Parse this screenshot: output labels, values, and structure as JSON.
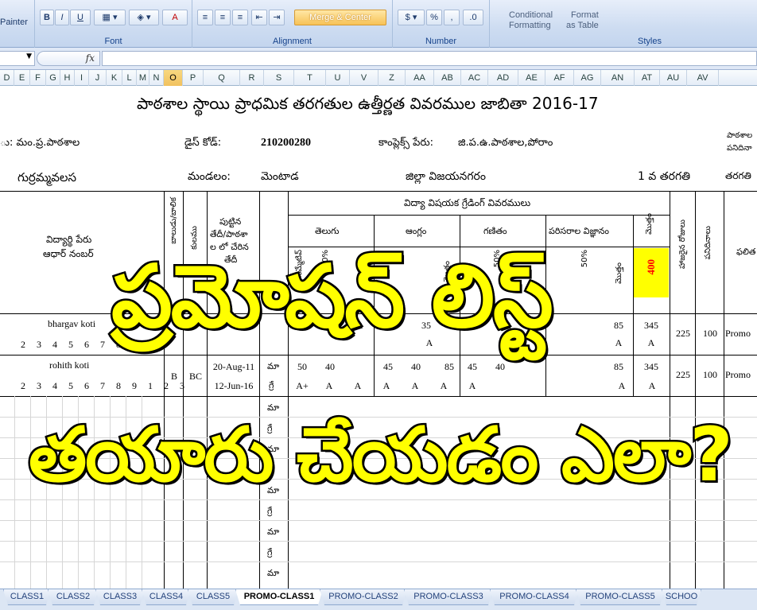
{
  "ribbon": {
    "painter_label": "Painter",
    "font_group": {
      "label": "Font",
      "bold": "B",
      "italic": "I",
      "underline": "U",
      "font_color": "A"
    },
    "alignment_group": {
      "label": "Alignment",
      "merge_center": "Merge & Center"
    },
    "number_group": {
      "label": "Number",
      "currency": "$",
      "percent": "%",
      "comma": ","
    },
    "styles_group": {
      "label": "Styles",
      "conditional_formatting": [
        "Conditional",
        "Formatting"
      ],
      "format_as_table": [
        "Format",
        "as Table"
      ]
    }
  },
  "formula_bar": {
    "fx": "fx",
    "value": ""
  },
  "columns": [
    "D",
    "E",
    "F",
    "G",
    "H",
    "I",
    "J",
    "K",
    "L",
    "M",
    "N",
    "O",
    "P",
    "Q",
    "R",
    "S",
    "T",
    "U",
    "V",
    "Z",
    "AA",
    "AB",
    "AC",
    "AD",
    "AE",
    "AF",
    "AG",
    "AN",
    "AT",
    "AU",
    "AV"
  ],
  "selected_column": "O",
  "sheet": {
    "title": "పాఠశాల స్థాయి ప్రాధమిక తరగతుల ఉత్తీర్ణత వివరముల జాబితా 2016-17",
    "school_label": "ు: మం.ప్ర.పాఠశాల",
    "dise_label": "డైస్ కోడ్:",
    "dise_value": "210200280",
    "complex_label": "కాంప్లెక్స్ పేరు:",
    "complex_value": "జి.ప.ఉ.పాఠశాల,పోరాం",
    "right_note_1": "పాఠశాల",
    "right_note_2": "పనిదినా",
    "village": "గుర్రమ్మవలస",
    "mandal_label": "మండలం:",
    "mandal_value": "మెంటాడ",
    "district": "జిల్లా విజయనగరం",
    "class_label": "1 వ తరగతి",
    "class_short": "తరగతి",
    "grading_header": "విద్యా విషయక గ్రేడింగ్ వివరములు",
    "student_name_header": "విద్యార్థి పేరు",
    "aadhaar_header": "ఆధార్ నంబర్",
    "dob_header": [
      "పుట్టిన",
      "తేదీ/పాఠశా",
      "ల లో చేరిన",
      "తేదీ"
    ],
    "subjects": [
      "తెలుగు",
      "ఆంగ్లం",
      "గణితం",
      "పరిసరాల విజ్ఞానం"
    ],
    "vertical_headers": {
      "gender": "బాలుడు/బాలిక",
      "caste": "కులము",
      "total": "మొత్తం",
      "attendance": "హాజరైన రోజులు",
      "working_days": "పనిదినాలు",
      "result": "ఫలిత",
      "sub_a": "సమ్మేటివ్",
      "sub_b": "50%",
      "sub_c": "మొత్తం"
    },
    "max_total": "400",
    "rows": [
      {
        "name": "bhargav koti",
        "aadhaar_digits": [
          "2",
          "3",
          "4",
          "5",
          "6",
          "7",
          "8"
        ],
        "marks_row": [
          "35",
          "",
          "",
          "85",
          "345"
        ],
        "grades_row": [
          "A",
          "",
          "A",
          "A"
        ],
        "attendance": "225",
        "working_days": "100",
        "result": "Promo"
      },
      {
        "name": "rohith koti",
        "aadhaar_digits": [
          "2",
          "3",
          "4",
          "5",
          "6",
          "7",
          "8",
          "9",
          "1",
          "2",
          "3"
        ],
        "gender": "B",
        "caste": "BC",
        "dob": "20-Aug-11",
        "join_date": "12-Jun-16",
        "ma": "మా",
        "gre": "గ్రే",
        "marks": [
          "50",
          "40",
          "45",
          "40",
          "85",
          "45",
          "40",
          "85",
          "345"
        ],
        "grades": [
          "A+",
          "A",
          "A",
          "A",
          "A",
          "A",
          "A",
          "A",
          "A"
        ],
        "attendance": "225",
        "working_days": "100",
        "result": "Promo"
      }
    ],
    "row_labels": [
      "మా",
      "గ్రే"
    ]
  },
  "overlay": {
    "line1": "ప్రమోషన్ లిస్ట్",
    "line2": "తయారు చేయడం ఎలా?",
    "color": "#ffff00"
  },
  "tabs": [
    "CLASS1",
    "CLASS2",
    "CLASS3",
    "CLASS4",
    "CLASS5",
    "PROMO-CLASS1",
    "PROMO-CLASS2",
    "PROMO-CLASS3",
    "PROMO-CLASS4",
    "PROMO-CLASS5",
    "SCHOO"
  ],
  "active_tab": "PROMO-CLASS1"
}
